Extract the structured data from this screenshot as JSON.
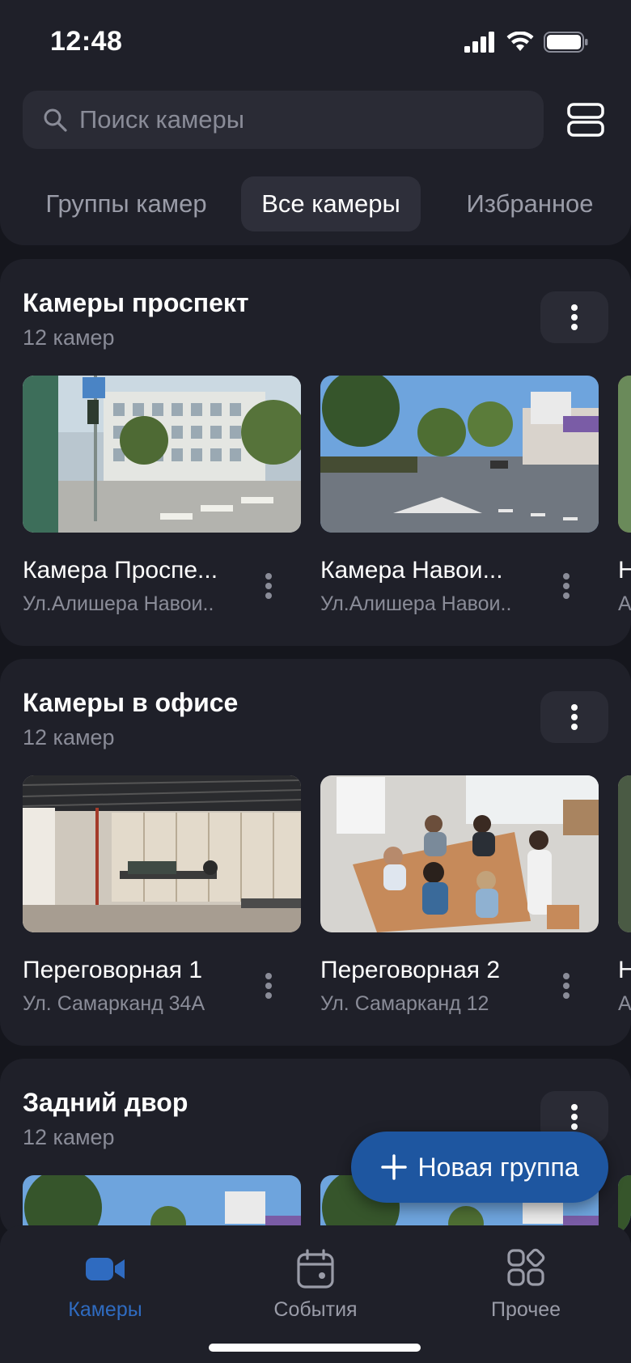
{
  "status_bar": {
    "time": "12:48"
  },
  "search": {
    "placeholder": "Поиск камеры"
  },
  "tabs": [
    {
      "label": "Группы камер",
      "active": false
    },
    {
      "label": "Все камеры",
      "active": true
    },
    {
      "label": "Избранное",
      "active": false
    }
  ],
  "groups": [
    {
      "title": "Камеры проспект",
      "count": "12 камер",
      "cameras": [
        {
          "name": "Камера Проспе...",
          "address": "Ул.Алишера Навои..",
          "scene": "street-building"
        },
        {
          "name": "Камера Навои...",
          "address": "Ул.Алишера Навои..",
          "scene": "avenue"
        },
        {
          "name": "Н",
          "address": "А",
          "scene": "street-building"
        }
      ]
    },
    {
      "title": "Камеры в офисе",
      "count": "12 камер",
      "cameras": [
        {
          "name": "Переговорная 1",
          "address": "Ул. Самарканд 34А",
          "scene": "office"
        },
        {
          "name": "Переговорная 2",
          "address": "Ул. Самарканд 12",
          "scene": "meeting"
        },
        {
          "name": "Н",
          "address": "А",
          "scene": "office"
        }
      ]
    },
    {
      "title": "Задний двор",
      "count": "12 камер",
      "cameras": [
        {
          "name": "",
          "address": "",
          "scene": "avenue"
        },
        {
          "name": "",
          "address": "",
          "scene": "avenue"
        },
        {
          "name": "",
          "address": "",
          "scene": "avenue"
        }
      ]
    }
  ],
  "fab": {
    "label": "Новая группа",
    "icon": "plus-icon"
  },
  "bottom_nav": [
    {
      "label": "Камеры",
      "icon": "video-camera-icon",
      "active": true
    },
    {
      "label": "События",
      "icon": "calendar-icon",
      "active": false
    },
    {
      "label": "Прочее",
      "icon": "grid-icon",
      "active": false
    }
  ],
  "colors": {
    "background": "#15161d",
    "surface": "#1f2029",
    "accent": "#1e56a0",
    "active_nav": "#2f6bc0"
  }
}
